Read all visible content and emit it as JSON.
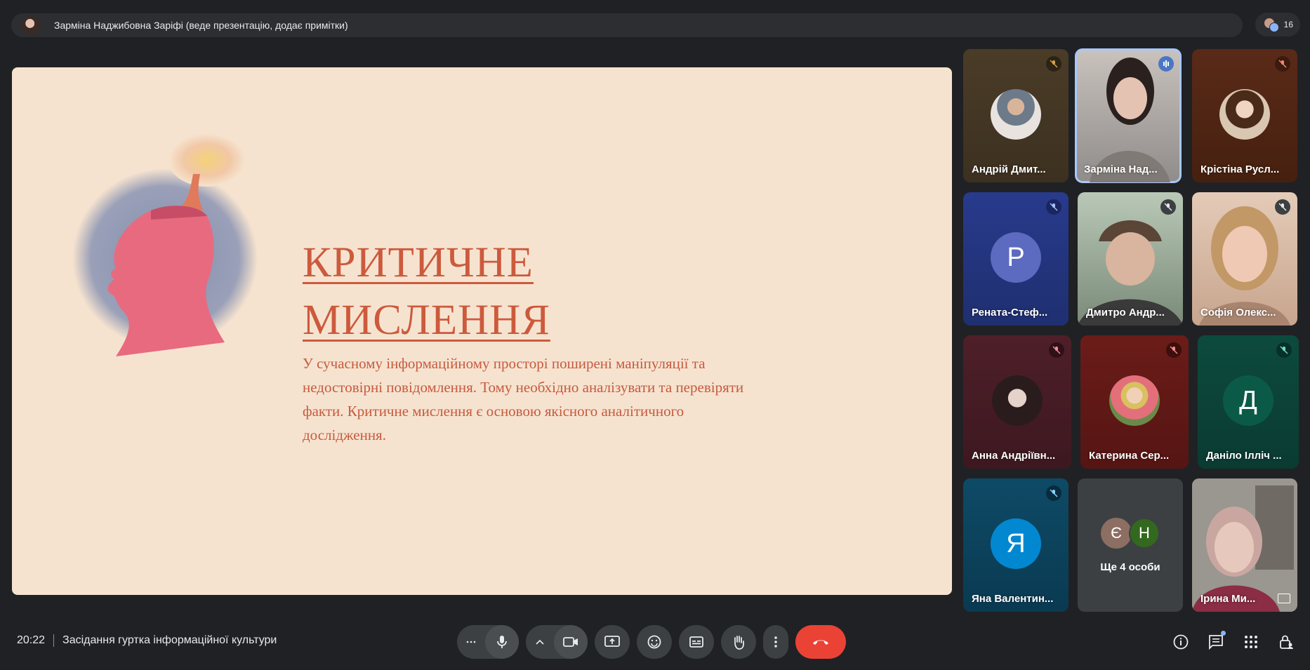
{
  "presenter_bar": {
    "text": "Зарміна Наджибовна Заріфі (веде презентацію, додає примітки)",
    "participants_count": "16"
  },
  "slide": {
    "title_line1": "КРИТИЧНЕ",
    "title_line2": "МИСЛЕННЯ",
    "body": "У сучасному інформаційному просторі поширені маніпуляції та недостовірні повідомлення. Тому необхідно аналізувати та перевіряти факти. Критичне мислення є основою якісного аналітичного дослідження.",
    "colors": {
      "background": "#f6e3cf",
      "text": "#cc5a3d"
    }
  },
  "participants": [
    {
      "name": "Андрій Дмит...",
      "muted": true
    },
    {
      "name": "Зарміна Над...",
      "muted": false,
      "speaking": true
    },
    {
      "name": "Крістіна Русл...",
      "muted": true
    },
    {
      "name": "Рената-Стеф...",
      "initial": "Р",
      "muted": true
    },
    {
      "name": "Дмитро Андр...",
      "muted": true
    },
    {
      "name": "Софія Олекс...",
      "muted": true
    },
    {
      "name": "Анна Андріївн...",
      "muted": true
    },
    {
      "name": "Катерина Сер...",
      "muted": true
    },
    {
      "name": "Даніло Ілліч ...",
      "initial": "Д",
      "muted": true
    },
    {
      "name": "Яна Валентин...",
      "initial": "Я",
      "muted": true
    },
    {
      "name": "Ще 4 особи",
      "initials": [
        "Є",
        "Н"
      ]
    },
    {
      "name": "Ірина Ми..."
    }
  ],
  "footer": {
    "time": "20:22",
    "meeting_title": "Засідання гуртка інформаційної культури"
  }
}
